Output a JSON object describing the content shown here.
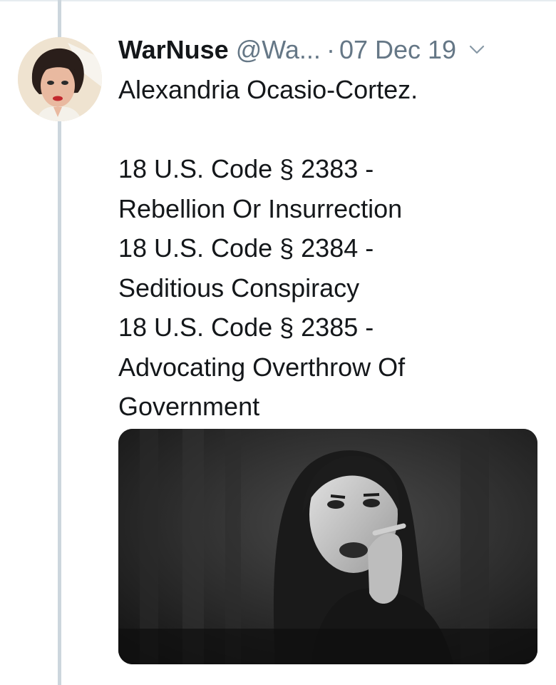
{
  "tweet": {
    "display_name": "WarNuse",
    "handle": "@Wa...",
    "separator": "·",
    "date": "07 Dec 19",
    "text": "Alexandria Ocasio-Cortez.\n\n18 U.S. Code § 2383 -\nRebellion Or Insurrection\n18 U.S. Code § 2384 -\nSeditious Conspiracy\n18 U.S. Code § 2385 -\nAdvocating Overthrow Of\nGovernment"
  },
  "icons": {
    "caret": "chevron-down-icon",
    "avatar": "avatar",
    "media": "photo"
  },
  "colors": {
    "text": "#14171a",
    "secondary": "#657786",
    "thread_line": "#ccd6dd",
    "border": "#e6ecf0"
  }
}
